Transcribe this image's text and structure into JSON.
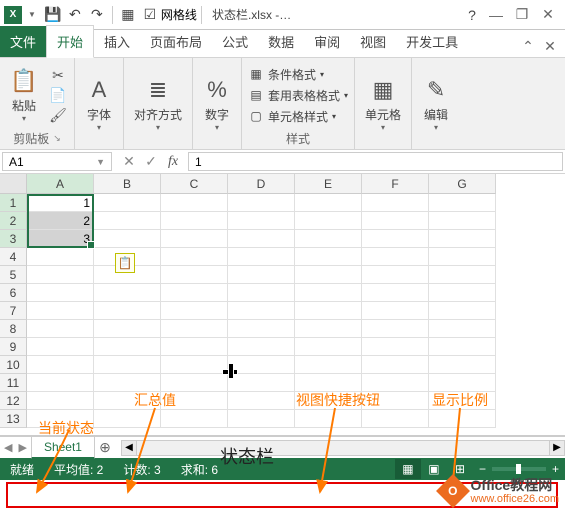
{
  "qat": {
    "logo": "X",
    "save_icon": "💾",
    "undo_icon": "↶",
    "redo_icon": "↷",
    "gridlines_icon": "▦",
    "gridlines_label": "网格线",
    "filename": "状态栏.xlsx -…",
    "help_icon": "?",
    "minimize": "—",
    "restore": "❐",
    "close": "✕"
  },
  "tabs": {
    "file": "文件",
    "home": "开始",
    "insert": "插入",
    "layout": "页面布局",
    "formulas": "公式",
    "data": "数据",
    "review": "审阅",
    "view": "视图",
    "dev": "开发工具"
  },
  "ribbon": {
    "clipboard": {
      "paste": "粘贴",
      "label": "剪贴板"
    },
    "font": {
      "btn": "字体"
    },
    "align": {
      "btn": "对齐方式"
    },
    "number": {
      "btn": "数字"
    },
    "styles": {
      "cond": "条件格式",
      "table": "套用表格格式",
      "cell": "单元格样式",
      "label": "样式"
    },
    "cells": {
      "btn": "单元格"
    },
    "editing": {
      "btn": "编辑"
    }
  },
  "namebox": "A1",
  "formula": "1",
  "columns": [
    "A",
    "B",
    "C",
    "D",
    "E",
    "F",
    "G"
  ],
  "rows": [
    "1",
    "2",
    "3",
    "4",
    "5",
    "6",
    "7",
    "8",
    "9",
    "10",
    "11",
    "12",
    "13"
  ],
  "cellA1": "1",
  "cellA2": "2",
  "cellA3": "3",
  "sheet": {
    "name": "Sheet1"
  },
  "status": {
    "ready": "就绪",
    "avg": "平均值: 2",
    "count": "计数: 3",
    "sum": "求和: 6"
  },
  "annotations": {
    "state": "当前状态",
    "summary": "汇总值",
    "viewbtns": "视图快捷按钮",
    "zoom": "显示比例",
    "title": "状态栏"
  },
  "watermark": {
    "logo": "O",
    "l1": "Office教程网",
    "l2": "www.office26.com"
  }
}
